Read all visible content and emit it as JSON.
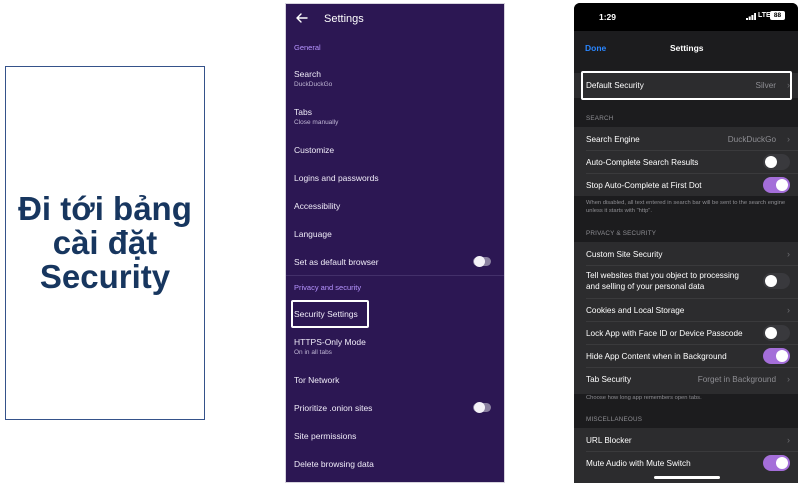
{
  "caption": {
    "text": "Đi tới bảng\ncài đặt\nSecurity"
  },
  "android": {
    "title": "Settings",
    "sections": {
      "general": "General",
      "privacy": "Privacy and security"
    },
    "items": {
      "search": "Search",
      "search_sub": "DuckDuckGo",
      "tabs": "Tabs",
      "tabs_sub": "Close manually",
      "customize": "Customize",
      "logins": "Logins and passwords",
      "accessibility": "Accessibility",
      "language": "Language",
      "default_browser": "Set as default browser",
      "security_settings": "Security Settings",
      "https_only": "HTTPS-Only Mode",
      "https_only_sub": "On in all tabs",
      "tor": "Tor Network",
      "onion": "Prioritize .onion sites",
      "site_permissions": "Site permissions",
      "delete_data": "Delete browsing data"
    },
    "toggles": {
      "default_browser": false,
      "onion": false
    }
  },
  "ios": {
    "status": {
      "time": "1:29",
      "network": "LTE",
      "battery": "88"
    },
    "nav": {
      "done": "Done",
      "title": "Settings"
    },
    "default_security": {
      "label": "Default Security",
      "value": "Silver"
    },
    "sections": {
      "search": "SEARCH",
      "privacy": "PRIVACY & SECURITY",
      "misc": "MISCELLANEOUS"
    },
    "search_engine": {
      "label": "Search Engine",
      "value": "DuckDuckGo"
    },
    "autocomplete": {
      "label": "Auto-Complete Search Results",
      "on": false
    },
    "stop_autocomplete": {
      "label": "Stop Auto-Complete at First Dot",
      "on": true
    },
    "search_footer": "When disabled, all text entered in search bar will be sent to the search engine unless it starts with \"http\".",
    "custom_site_security": {
      "label": "Custom Site Security"
    },
    "tell_websites": {
      "label_line1": "Tell websites that you object to processing",
      "label_line2": "and selling of your personal data",
      "on": false
    },
    "cookies": {
      "label": "Cookies and Local Storage"
    },
    "lock_app": {
      "label": "Lock App with Face ID or Device Passcode",
      "on": false
    },
    "hide_content": {
      "label": "Hide App Content when in Background",
      "on": true
    },
    "tab_security": {
      "label": "Tab Security",
      "value": "Forget in Background"
    },
    "tab_footer": "Choose how long app remembers open tabs.",
    "url_blocker": {
      "label": "URL Blocker"
    },
    "mute_audio": {
      "label": "Mute Audio with Mute Switch",
      "on": true
    },
    "colors": {
      "accent": "#2a86ff",
      "toggle_on": "#a46ed9",
      "android_bg": "#2c1753",
      "section_purple": "#b694ff"
    }
  }
}
